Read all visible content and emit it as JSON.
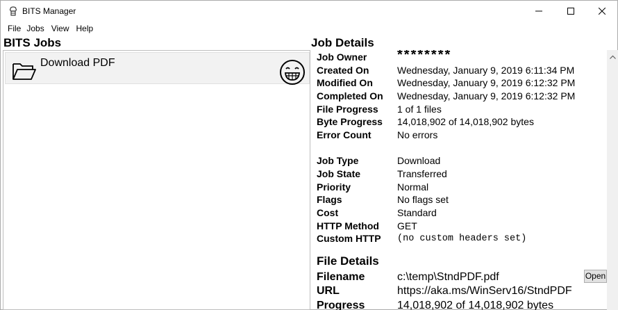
{
  "window": {
    "title": "BITS Manager"
  },
  "menu": [
    {
      "label": "File"
    },
    {
      "label": "Jobs"
    },
    {
      "label": "View"
    },
    {
      "label": "Help"
    }
  ],
  "jobs": {
    "header": "BITS Jobs",
    "items": [
      {
        "name": "Download PDF",
        "icon": "folder-icon",
        "status_icon": "smiley-icon"
      }
    ]
  },
  "details": {
    "header": "Job Details",
    "rows": [
      {
        "key": "Job Owner",
        "value": "********"
      },
      {
        "key": "Created On",
        "value": "Wednesday, January 9, 2019 6:11:34 PM"
      },
      {
        "key": "Modified On",
        "value": "Wednesday, January 9, 2019 6:12:32 PM"
      },
      {
        "key": "Completed On",
        "value": "Wednesday, January 9, 2019 6:12:32 PM"
      },
      {
        "key": "File Progress",
        "value": "1 of 1 files"
      },
      {
        "key": "Byte Progress",
        "value": "14,018,902 of 14,018,902 bytes"
      },
      {
        "key": "Error Count",
        "value": "No errors"
      },
      {
        "key": "Job Type",
        "value": "Download"
      },
      {
        "key": "Job State",
        "value": "Transferred"
      },
      {
        "key": "Priority",
        "value": "Normal"
      },
      {
        "key": "Flags",
        "value": "No flags set"
      },
      {
        "key": "Cost",
        "value": "Standard"
      },
      {
        "key": "HTTP Method",
        "value": "GET"
      },
      {
        "key": "Custom HTTP",
        "value": "(no custom headers set)"
      }
    ]
  },
  "file_details": {
    "header": "File Details",
    "rows": [
      {
        "key": "Filename",
        "value": "c:\\temp\\StndPDF.pdf"
      },
      {
        "key": "URL",
        "value": "https://aka.ms/WinServ16/StndPDF"
      },
      {
        "key": "Progress",
        "value": "14,018,902 of 14,018,902 bytes"
      }
    ],
    "open_label": "Open"
  }
}
